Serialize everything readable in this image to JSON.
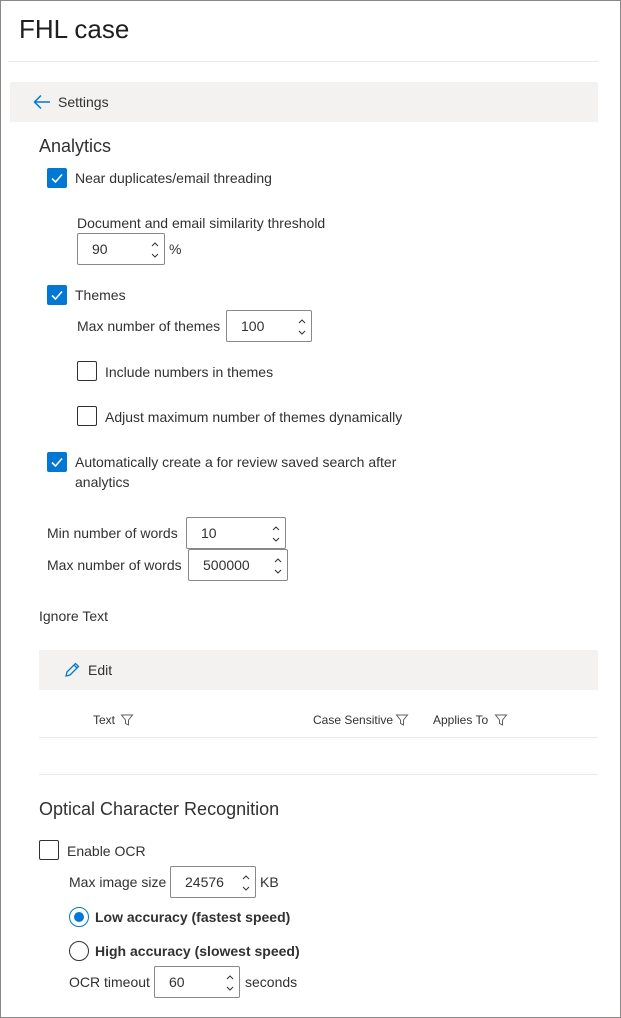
{
  "header": {
    "title": "FHL case"
  },
  "nav": {
    "back_label": "Settings",
    "back_icon": "arrow-left-icon"
  },
  "analytics": {
    "heading": "Analytics",
    "near_duplicates": {
      "label": "Near duplicates/email threading",
      "checked": true
    },
    "similarity": {
      "label": "Document and email similarity threshold",
      "value": "90",
      "unit": "%"
    },
    "themes": {
      "label": "Themes",
      "checked": true
    },
    "max_themes": {
      "label": "Max number of themes",
      "value": "100"
    },
    "include_numbers": {
      "label": "Include numbers in themes",
      "checked": false
    },
    "adjust_dynamic": {
      "label": "Adjust maximum number of themes dynamically",
      "checked": false
    },
    "auto_create": {
      "label_line1": "Automatically create a for review saved search after",
      "label_line2": "analytics",
      "checked": true
    },
    "min_words": {
      "label": "Min number of words",
      "value": "10"
    },
    "max_words": {
      "label": "Max number of words",
      "value": "500000"
    }
  },
  "ignore_text": {
    "heading": "Ignore Text",
    "edit_label": "Edit",
    "columns": [
      "Text",
      "Case Sensitive",
      "Applies To"
    ]
  },
  "ocr": {
    "heading": "Optical Character Recognition",
    "enable": {
      "label": "Enable OCR",
      "checked": false
    },
    "max_image_size": {
      "label": "Max image size",
      "value": "24576",
      "unit": "KB"
    },
    "low_accuracy": {
      "label": "Low accuracy (fastest speed)",
      "selected": true
    },
    "high_accuracy": {
      "label": "High accuracy (slowest speed)",
      "selected": false
    },
    "timeout": {
      "label": "OCR timeout",
      "value": "60",
      "unit": "seconds"
    }
  },
  "colors": {
    "accent": "#0078d4",
    "bar": "#f3f2f1",
    "border": "#8a8886"
  }
}
